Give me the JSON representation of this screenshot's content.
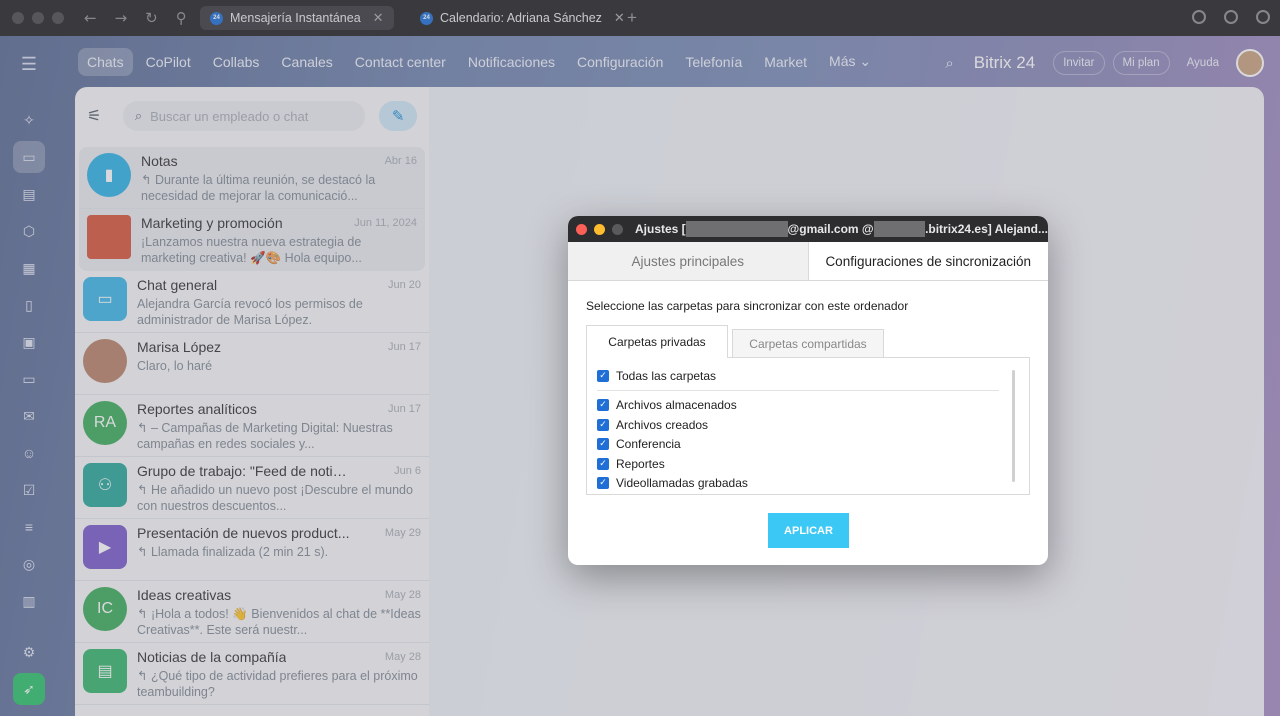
{
  "browser": {
    "tabs": [
      {
        "label": "Mensajería Instantánea",
        "favicon": "24"
      },
      {
        "label": "Calendario: Adriana Sánchez",
        "favicon": "24"
      }
    ]
  },
  "topnav": {
    "items": [
      "Chats",
      "CoPilot",
      "Collabs",
      "Canales",
      "Contact center",
      "Notificaciones",
      "Configuración",
      "Telefonía",
      "Market",
      "Más ⌄"
    ],
    "brand": "Bitrix 24",
    "invite": "Invitar",
    "plan": "Mi plan",
    "help": "Ayuda"
  },
  "chatlist": {
    "search_placeholder": "Buscar un empleado o chat",
    "items": [
      {
        "name": "Notas",
        "date": "Abr 16",
        "msg": "↰ Durante la última reunión, se destacó la necesidad de mejorar la comunicació...",
        "avatar_color": "#2fb3e6",
        "icon": "bookmark-icon"
      },
      {
        "name": "Marketing y promoción",
        "date": "Jun 11, 2024",
        "msg": "¡Lanzamos nuestra nueva estrategia de marketing creativa! 🚀🎨 Hola equipo...",
        "avatar_color": "#d9573b"
      },
      {
        "name": "Chat general",
        "date": "Jun 20",
        "msg": "Alejandra García revocó los permisos de administrador de Marisa López.",
        "avatar_color": "#3fb8e8"
      },
      {
        "name": "Marisa López",
        "date": "Jun 17",
        "msg": "Claro, lo haré",
        "avatar_color": "#b9836a"
      },
      {
        "name": "Reportes analíticos",
        "date": "Jun 17",
        "msg": "↰ – Campañas de Marketing Digital: Nuestras campañas en redes sociales y...",
        "avatar_color": "#3dad5c",
        "initials": "RA"
      },
      {
        "name": "Grupo de trabajo: \"Feed de notici...",
        "date": "Jun 6",
        "msg": "↰ He añadido un nuevo post ¡Descubre el mundo con nuestros descuentos...",
        "avatar_color": "#2aa89b"
      },
      {
        "name": "Presentación de nuevos product...",
        "date": "May 29",
        "msg": "↰ Llamada finalizada (2 min 21 s).",
        "avatar_color": "#7a5ccc"
      },
      {
        "name": "Ideas creativas",
        "date": "May 28",
        "msg": "↰ ¡Hola a todos! 👋 Bienvenidos al chat de **Ideas Creativas**. Este será nuestr...",
        "avatar_color": "#3dad5c",
        "initials": "IC"
      },
      {
        "name": "Noticias de la compañía",
        "date": "May 28",
        "msg": "↰ ¿Qué tipo de actividad prefieres para el próximo teambuilding?",
        "avatar_color": "#36b86e"
      }
    ]
  },
  "dialog": {
    "title_prefix": "Ajustes [",
    "title_mid1": "@gmail.com @",
    "title_mid2": ".bitrix24.es] Alejand...",
    "tab_main": "Ajustes principales",
    "tab_sync": "Configuraciones de sincronización",
    "instruction": "Seleccione las carpetas para sincronizar con este ordenador",
    "subtab_private": "Carpetas privadas",
    "subtab_shared": "Carpetas compartidas",
    "all_folders": "Todas las carpetas",
    "folders": [
      "Archivos almacenados",
      "Archivos creados",
      "Conferencia",
      "Reportes",
      "Videollamadas grabadas"
    ],
    "apply": "APLICAR"
  }
}
